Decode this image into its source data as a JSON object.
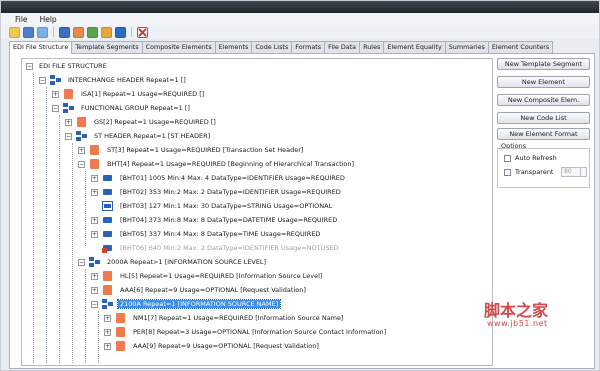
{
  "menu": {
    "file": "File",
    "help": "Help"
  },
  "tabs": [
    {
      "label": "EDI File Structure"
    },
    {
      "label": "Template Segments"
    },
    {
      "label": "Composite Elements"
    },
    {
      "label": "Elements"
    },
    {
      "label": "Code Lists"
    },
    {
      "label": "Formats"
    },
    {
      "label": "File Data"
    },
    {
      "label": "Rules"
    },
    {
      "label": "Element Equality"
    },
    {
      "label": "Summaries"
    },
    {
      "label": "Element Counters"
    }
  ],
  "tree": {
    "rows": [
      {
        "label": "EDI FILE STRUCTURE",
        "icon": "none"
      },
      {
        "label": "INTERCHANGE HEADER Repeat=1 []",
        "icon": "group-icon"
      },
      {
        "label": "ISA[1] Repeat=1 Usage=REQUIRED  []",
        "icon": "segment-icon"
      },
      {
        "label": "FUNCTIONAL GROUP Repeat=1 []",
        "icon": "group-icon"
      },
      {
        "label": "GS[2] Repeat=1 Usage=REQUIRED  []",
        "icon": "segment-icon"
      },
      {
        "label": "ST HEADER Repeat=1 [ST HEADER]",
        "icon": "group-icon"
      },
      {
        "label": "ST[3] Repeat=1 Usage=REQUIRED  [Transaction Set Header]",
        "icon": "segment-icon"
      },
      {
        "label": "BHT[4] Repeat=1 Usage=REQUIRED  [Beginning of Hierarchical Transaction]",
        "icon": "segment-icon"
      },
      {
        "label": "[BHT01]  1005  Min:4  Max: 4  DataType=IDENTIFIER Usage=REQUIRED",
        "icon": "element-icon"
      },
      {
        "label": "[BHT02]  353  Min:2  Max: 2  DataType=IDENTIFIER Usage=REQUIRED",
        "icon": "element-icon"
      },
      {
        "label": "[BHT03]  127  Min:1  Max: 30  DataType=STRING Usage=OPTIONAL",
        "icon": "element-optional-icon"
      },
      {
        "label": "[BHT04]  373  Min:8  Max: 8  DataType=DATETIME Usage=REQUIRED",
        "icon": "element-icon"
      },
      {
        "label": "[BHT05]  337  Min:4  Max: 8  DataType=TIME Usage=REQUIRED",
        "icon": "element-icon"
      },
      {
        "label": "[BHT06]  640  Min:2  Max: 2  DataType=IDENTIFIER Usage=NOTUSED",
        "icon": "element-notused-icon"
      },
      {
        "label": "2000A Repeat>1 [INFORMATION SOURCE LEVEL]",
        "icon": "group-icon"
      },
      {
        "label": "HL[5] Repeat=1 Usage=REQUIRED  [Information Source Level]",
        "icon": "segment-icon"
      },
      {
        "label": "AAA[6] Repeat=9 Usage=OPTIONAL  [Request Validation]",
        "icon": "segment-icon"
      },
      {
        "label": "2100A Repeat=1 [INFORMATION SOURCE NAME]",
        "icon": "group-icon"
      },
      {
        "label": "NM1[7] Repeat=1 Usage=REQUIRED  [Information Source Name]",
        "icon": "segment-icon"
      },
      {
        "label": "PER[8] Repeat=3 Usage=OPTIONAL  [Information Source Contact Information]",
        "icon": "segment-icon"
      },
      {
        "label": "AAA[9] Repeat=9 Usage=OPTIONAL  [Request Validation]",
        "icon": "segment-icon"
      }
    ]
  },
  "side": {
    "buttons": {
      "new_template_segment": "New Template Segment",
      "new_element": "New Element",
      "new_composite": "New Composite Elem.",
      "new_code_list": "New Code List",
      "new_element_format": "New Element Format"
    },
    "options": {
      "title": "Options",
      "auto_refresh": "Auto Refresh",
      "transparent": "Transparent",
      "transparency_value": "80"
    }
  },
  "watermark": {
    "text": "脚本之家",
    "url": "www.jb51.net"
  },
  "colors": {
    "selection": "#3d8ee8",
    "segment_icon": "#f07a4f",
    "element_icon": "#2a62b8",
    "group_icon": "#2a62b8"
  }
}
